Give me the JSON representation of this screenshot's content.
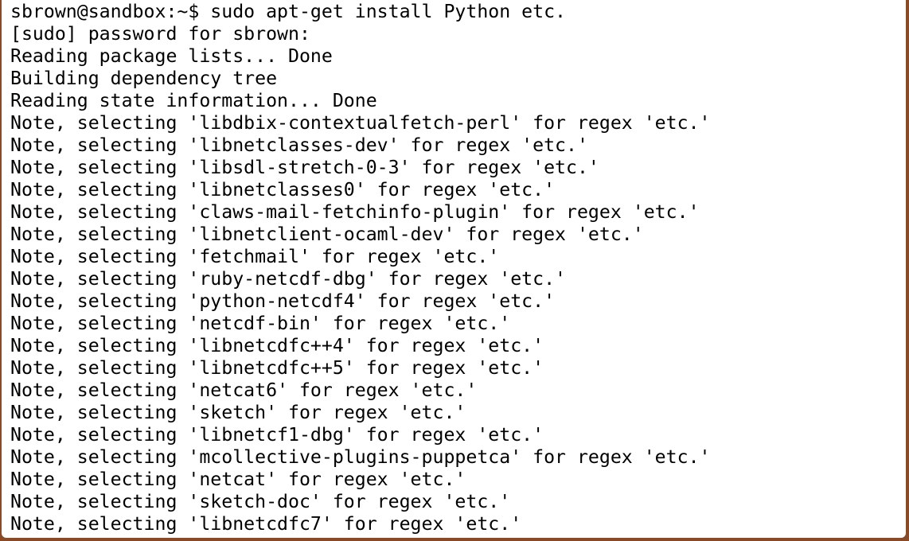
{
  "terminal": {
    "lines": [
      "sbrown@sandbox:~$ sudo apt-get install Python etc.",
      "[sudo] password for sbrown:",
      "Reading package lists... Done",
      "Building dependency tree",
      "Reading state information... Done",
      "Note, selecting 'libdbix-contextualfetch-perl' for regex 'etc.'",
      "Note, selecting 'libnetclasses-dev' for regex 'etc.'",
      "Note, selecting 'libsdl-stretch-0-3' for regex 'etc.'",
      "Note, selecting 'libnetclasses0' for regex 'etc.'",
      "Note, selecting 'claws-mail-fetchinfo-plugin' for regex 'etc.'",
      "Note, selecting 'libnetclient-ocaml-dev' for regex 'etc.'",
      "Note, selecting 'fetchmail' for regex 'etc.'",
      "Note, selecting 'ruby-netcdf-dbg' for regex 'etc.'",
      "Note, selecting 'python-netcdf4' for regex 'etc.'",
      "Note, selecting 'netcdf-bin' for regex 'etc.'",
      "Note, selecting 'libnetcdfc++4' for regex 'etc.'",
      "Note, selecting 'libnetcdfc++5' for regex 'etc.'",
      "Note, selecting 'netcat6' for regex 'etc.'",
      "Note, selecting 'sketch' for regex 'etc.'",
      "Note, selecting 'libnetcf1-dbg' for regex 'etc.'",
      "Note, selecting 'mcollective-plugins-puppetca' for regex 'etc.'",
      "Note, selecting 'netcat' for regex 'etc.'",
      "Note, selecting 'sketch-doc' for regex 'etc.'",
      "Note, selecting 'libnetcdfc7' for regex 'etc.'"
    ]
  },
  "colors": {
    "background": "#ffffff",
    "text": "#000000",
    "window_frame": "#8a4a26"
  }
}
